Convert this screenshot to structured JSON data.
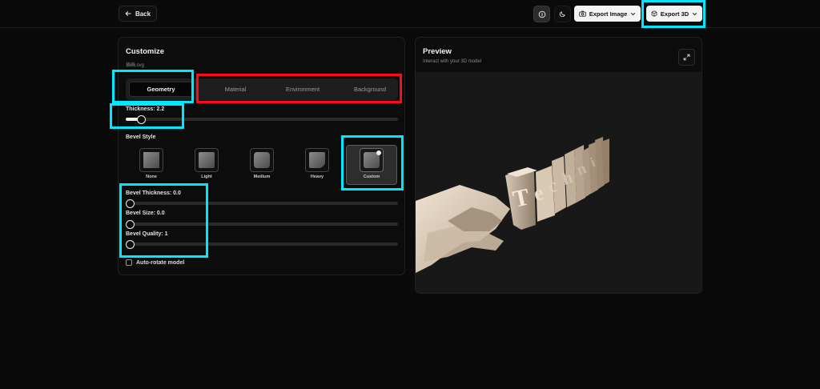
{
  "header": {
    "back_label": "Back",
    "export_image_label": "Export Image",
    "export_3d_label": "Export 3D"
  },
  "customize": {
    "title": "Customize",
    "filename": "插画.svg",
    "tabs": [
      {
        "label": "Geometry",
        "active": true
      },
      {
        "label": "Material",
        "active": false
      },
      {
        "label": "Environment",
        "active": false
      },
      {
        "label": "Background",
        "active": false
      }
    ],
    "thickness": {
      "label": "Thickness: 2.2",
      "value": 2.2
    },
    "bevel_style_title": "Bevel Style",
    "bevel_options": [
      {
        "label": "None"
      },
      {
        "label": "Light"
      },
      {
        "label": "Medium"
      },
      {
        "label": "Heavy"
      },
      {
        "label": "Custom",
        "selected": true
      }
    ],
    "bevel_thickness": {
      "label": "Bevel Thickness: 0.0",
      "value": 0.0
    },
    "bevel_size": {
      "label": "Bevel Size: 0.0",
      "value": 0.0
    },
    "bevel_quality": {
      "label": "Bevel Quality: 1",
      "value": 1
    },
    "auto_rotate_label": "Auto-rotate model",
    "auto_rotate_checked": false
  },
  "preview": {
    "title": "Preview",
    "subtitle": "Interact with your 3D model"
  },
  "colors": {
    "highlight_cyan": "#00e8ff",
    "highlight_red": "#ff0a16",
    "model_color": "#e3d3c0"
  },
  "icons": {
    "back": "arrow-left-icon",
    "info": "info-icon",
    "theme": "moon-icon",
    "camera": "camera-icon",
    "cube": "cube-icon",
    "dropdown": "chevron-down-icon",
    "expand": "expand-icon"
  }
}
